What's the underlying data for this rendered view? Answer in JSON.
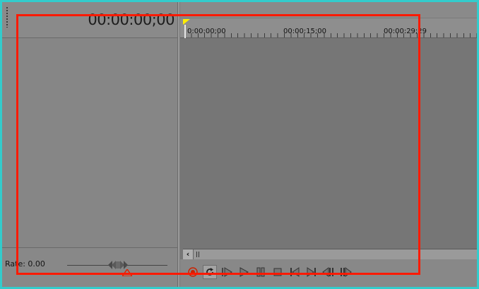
{
  "timeline": {
    "current_timecode": "00:00:00;00",
    "ruler_labels": [
      "0:00:00;00",
      "00:00:15;00",
      "00:00:29;29"
    ]
  },
  "rate": {
    "label": "Rate: 0.00"
  },
  "transport": {
    "buttons": [
      "record-icon",
      "loop-icon",
      "play-from-start-icon",
      "play-icon",
      "pause-icon",
      "stop-icon",
      "go-to-start-icon",
      "go-to-end-icon",
      "previous-frame-icon",
      "next-frame-icon"
    ]
  },
  "colors": {
    "highlight_box": "#ff1a00",
    "background": "#33cccc",
    "record": "#cc2200",
    "ruler_marker": "#ffee00"
  }
}
